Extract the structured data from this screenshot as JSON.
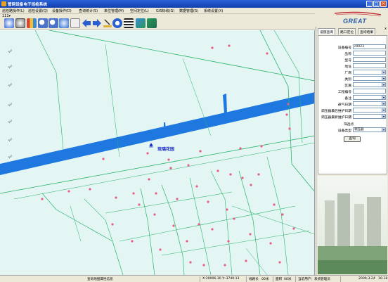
{
  "window": {
    "title": "管网设备电子巡检系统"
  },
  "menu": [
    "巡检路操作(L)",
    "巡检设置(Q)",
    "设备操作(D)",
    "查询统计(S)",
    "来位管理(M)",
    "空间定位(L)",
    "GIS标绘(G)",
    "数据管理(S)",
    "系统设置(X)"
  ],
  "brand": {
    "logo": "GREAT"
  },
  "toolbar": {
    "dropdown": "111"
  },
  "map": {
    "place_label": "琉璃花园"
  },
  "panel": {
    "close": "x",
    "tabs": [
      "设施查询",
      "路口定位",
      "查询结果"
    ],
    "fields": [
      {
        "label": "设备编号",
        "value": "c0023",
        "dropdown": false
      },
      {
        "label": "品称",
        "value": "",
        "dropdown": false
      },
      {
        "label": "型号",
        "value": "",
        "dropdown": false
      },
      {
        "label": "地址",
        "value": "",
        "dropdown": false
      },
      {
        "label": "厂商",
        "value": "",
        "dropdown": true
      },
      {
        "label": "类别",
        "value": "",
        "dropdown": true
      },
      {
        "label": "区属",
        "value": "",
        "dropdown": true
      },
      {
        "label": "工程编号",
        "value": "",
        "dropdown": false
      },
      {
        "label": "备注",
        "value": "",
        "dropdown": true
      },
      {
        "label": "通气日期",
        "value": "",
        "dropdown": true
      },
      {
        "label": "调压器最后维护日期",
        "value": "",
        "dropdown": true
      },
      {
        "label": "调压器最新维护日期",
        "value": "",
        "dropdown": true
      }
    ],
    "section": "筛选点",
    "device_type_label": "设备类型",
    "device_type_value": "调压器",
    "query_button": "查询"
  },
  "status": {
    "layer": "查询地图属性信息",
    "coords": "X:20006.30 Y:-3740.13",
    "distance": "线路长",
    "d1": "00米",
    "area": "面积",
    "d2": "00米",
    "user": "当前用户：系统管理员",
    "date": "2009-3-24",
    "time": "16:18"
  },
  "colors": {
    "map_bg": "#e4f6f3",
    "river": "#1e78e0",
    "pipe": "#27b36a",
    "marker": "#e85c8a",
    "title_bar": "#1f4fc8"
  }
}
